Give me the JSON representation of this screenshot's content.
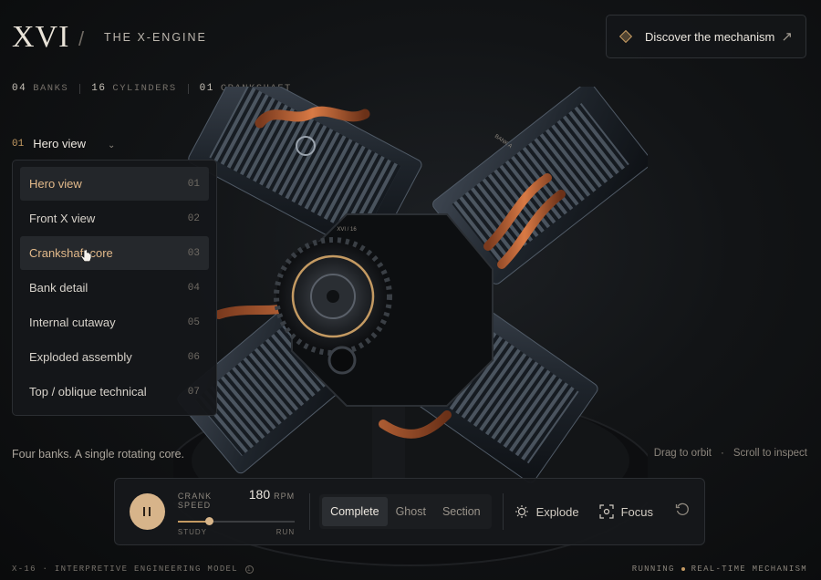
{
  "header": {
    "logo": "XVI",
    "slash": "/",
    "title": "THE X-ENGINE",
    "cta_label": "Discover the mechanism"
  },
  "stats": [
    {
      "num": "04",
      "label": "BANKS"
    },
    {
      "num": "16",
      "label": "CYLINDERS"
    },
    {
      "num": "01",
      "label": "CRANKSHAFT"
    }
  ],
  "view_selector": {
    "current_num": "01",
    "current_label": "Hero view",
    "options": [
      {
        "label": "Hero view",
        "num": "01"
      },
      {
        "label": "Front X view",
        "num": "02"
      },
      {
        "label": "Crankshaft core",
        "num": "03"
      },
      {
        "label": "Bank detail",
        "num": "04"
      },
      {
        "label": "Internal cutaway",
        "num": "05"
      },
      {
        "label": "Exploded assembly",
        "num": "06"
      },
      {
        "label": "Top / oblique technical",
        "num": "07"
      }
    ]
  },
  "engine": {
    "bank_label": "BANK A",
    "core_label": "XVI / 16"
  },
  "tagline": "Four banks. A single rotating core.",
  "hints": {
    "orbit": "Drag to orbit",
    "sep": "·",
    "inspect": "Scroll to inspect"
  },
  "controls": {
    "speed_label": "CRANK SPEED",
    "speed_value": "180",
    "speed_unit": "RPM",
    "speed_fraction": 0.27,
    "slider_min": "STUDY",
    "slider_max": "RUN",
    "modes": [
      "Complete",
      "Ghost",
      "Section"
    ],
    "active_mode": "Complete",
    "explode_label": "Explode",
    "focus_label": "Focus"
  },
  "footer": {
    "left": "X-16 · INTERPRETIVE ENGINEERING MODEL",
    "status": "RUNNING",
    "mode": "REAL-TIME MECHANISM"
  },
  "colors": {
    "accent": "#c49a62",
    "accent_light": "#e2b98a",
    "background": "#121416"
  }
}
